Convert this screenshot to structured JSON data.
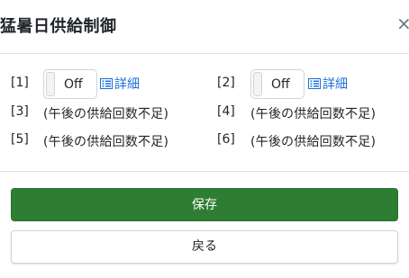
{
  "dialog": {
    "title": "猛暑日供給制御",
    "close_label": "×"
  },
  "rows": [
    {
      "label": "[1]",
      "toggle": "Off",
      "detail": "詳細"
    },
    {
      "label": "[2]",
      "toggle": "Off",
      "detail": "詳細"
    },
    {
      "label": "[3]",
      "status": "(午後の供給回数不足)"
    },
    {
      "label": "[4]",
      "status": "(午後の供給回数不足)"
    },
    {
      "label": "[5]",
      "status": "(午後の供給回数不足)"
    },
    {
      "label": "[6]",
      "status": "(午後の供給回数不足)"
    }
  ],
  "footer": {
    "save_label": "保存",
    "back_label": "戻る"
  },
  "colors": {
    "save_button": "#2e7d32",
    "link": "#1a6fd6"
  },
  "icons": {
    "detail": "list-icon",
    "close": "close-icon"
  }
}
